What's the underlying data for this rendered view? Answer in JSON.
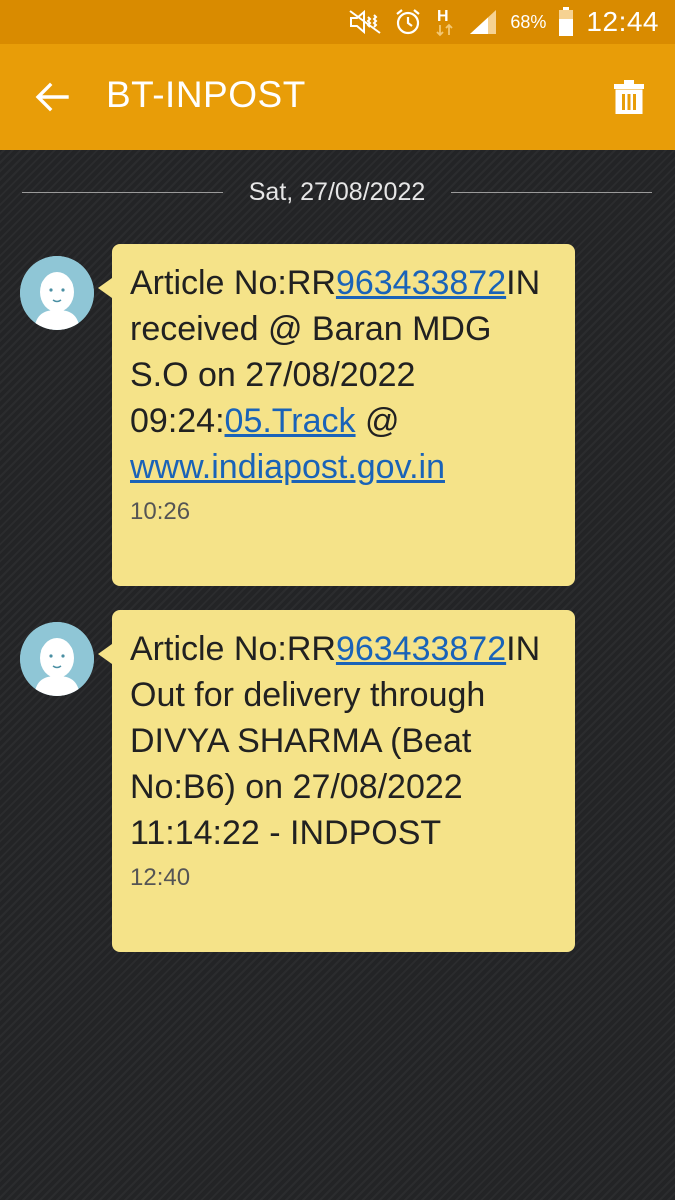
{
  "status_bar": {
    "battery_percent": "68%",
    "time": "12:44"
  },
  "app_bar": {
    "title": "BT-INPOST"
  },
  "date_divider": "Sat, 27/08/2022",
  "messages": [
    {
      "p1": "Article No:RR",
      "link1": "963433872",
      "p2": "IN received @ Baran MDG S.O on 27/08/2022 09:24:",
      "link2": "05.Track",
      "p3": " @ ",
      "link3": "www.indiapost.gov.in",
      "time": "10:26"
    },
    {
      "p1": "Article No:RR",
      "link1": "963433872",
      "p2": "IN Out for delivery through DIVYA SHARMA (Beat No:B6) on 27/08/2022 11:14:22 - INDPOST",
      "time": "12:40"
    }
  ],
  "colors": {
    "status_bar": "#d98b00",
    "app_bar": "#e89d08",
    "bubble": "#f5e389",
    "link": "#1a63b8",
    "background": "#232426"
  }
}
